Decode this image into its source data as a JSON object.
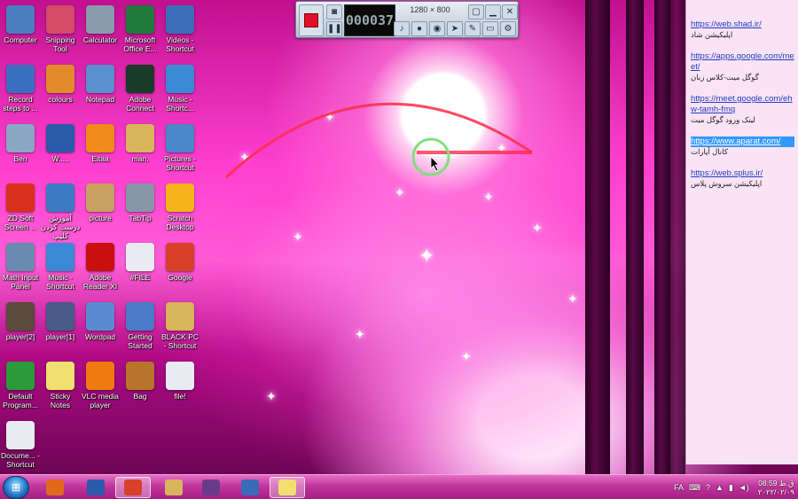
{
  "desktop": {
    "icons": [
      {
        "label": "Computer",
        "icon": "computer-icon",
        "color": "#4a7fc0"
      },
      {
        "label": "Snipping Tool",
        "icon": "scissors-icon",
        "color": "#d64a6a"
      },
      {
        "label": "Calculator",
        "icon": "calculator-icon",
        "color": "#8a9bb0"
      },
      {
        "label": "Microsoft Office E...",
        "icon": "excel-icon",
        "color": "#1f7a3c"
      },
      {
        "label": "Videos - Shortcut",
        "icon": "video-icon",
        "color": "#3d6fb8"
      },
      {
        "label": "Record steps to ...",
        "icon": "record-steps-icon",
        "color": "#3a6fbf"
      },
      {
        "label": "colours",
        "icon": "paint-icon",
        "color": "#e58a2b"
      },
      {
        "label": "Notepad",
        "icon": "notepad-icon",
        "color": "#5a8fd0"
      },
      {
        "label": "Adobe Connect",
        "icon": "adobe-connect-icon",
        "color": "#1a3a2a"
      },
      {
        "label": "Music - Shortc...",
        "icon": "music-icon",
        "color": "#3a8ad6"
      },
      {
        "label": "Ben",
        "icon": "recycle-bin-icon",
        "color": "#8aa6c4"
      },
      {
        "label": "W.....",
        "icon": "word-icon",
        "color": "#2a5aaa"
      },
      {
        "label": "Eitaa",
        "icon": "eitaa-icon",
        "color": "#f08a1a"
      },
      {
        "label": "man.",
        "icon": "folder-icon",
        "color": "#d8b45a"
      },
      {
        "label": "Pictures - Shortcut",
        "icon": "pictures-icon",
        "color": "#4b86c8"
      },
      {
        "label": "ZD Soft Screen ...",
        "icon": "zd-soft-icon",
        "color": "#d8301a"
      },
      {
        "label": "آموزش درست کردن کلیپ",
        "icon": "monitor-icon",
        "color": "#3d7ac4"
      },
      {
        "label": "picture",
        "icon": "palette-icon",
        "color": "#c8a060"
      },
      {
        "label": "TabTip",
        "icon": "pen-icon",
        "color": "#8897a8"
      },
      {
        "label": "Scratch Desktop",
        "icon": "scratch-icon",
        "color": "#f5b41c"
      },
      {
        "label": "Math Input Panel",
        "icon": "math-input-icon",
        "color": "#6a8ab0"
      },
      {
        "label": "Music - Shortcut",
        "icon": "music-icon",
        "color": "#3a8ad6"
      },
      {
        "label": "Adobe Reader XI",
        "icon": "pdf-icon",
        "color": "#c81010"
      },
      {
        "label": "#FILE",
        "icon": "file-icon",
        "color": "#e8ecf2"
      },
      {
        "label": "Google",
        "icon": "chrome-icon",
        "color": "#d8402a"
      },
      {
        "label": "player[2]",
        "icon": "film-icon",
        "color": "#5a4a3a"
      },
      {
        "label": "player[1]",
        "icon": "film-icon",
        "color": "#4a5a8a"
      },
      {
        "label": "Wordpad",
        "icon": "wordpad-icon",
        "color": "#5a8ad0"
      },
      {
        "label": "Getting Started",
        "icon": "getting-started-icon",
        "color": "#4a7ac8"
      },
      {
        "label": "BLACK PC - Shortcut",
        "icon": "folder-icon",
        "color": "#d8b45a"
      },
      {
        "label": "Default Program...",
        "icon": "default-programs-icon",
        "color": "#2a9a3a"
      },
      {
        "label": "Sticky Notes",
        "icon": "sticky-notes-icon",
        "color": "#f0e070"
      },
      {
        "label": "VLC media player",
        "icon": "vlc-icon",
        "color": "#f07a10"
      },
      {
        "label": "Bag",
        "icon": "bag-icon",
        "color": "#b8742a"
      },
      {
        "label": "file!",
        "icon": "document-icon",
        "color": "#e8ecf2"
      },
      {
        "label": "Docume... - Shortcut",
        "icon": "documents-icon",
        "color": "#e8ecf2"
      }
    ]
  },
  "recorder": {
    "timer": "000037",
    "resolution": "1280 × 800",
    "icons": [
      "stop-record-icon",
      "camera-icon",
      "pause-icon",
      "window-icon",
      "minimize-icon",
      "close-icon",
      "speaker-icon",
      "microphone-icon",
      "webcam-icon",
      "cursor-icon",
      "pencil-icon",
      "folder-icon",
      "gear-icon"
    ]
  },
  "note": {
    "entries": [
      {
        "url": "https://web.shad.ir/",
        "desc": "اپلیکیشن شاد",
        "selected": false
      },
      {
        "url": "https://apps.google.com/meet/",
        "desc": "گوگل میت-کلاس زبان",
        "selected": false
      },
      {
        "url": "https://meet.google.com/ehw-tamh-fmq",
        "desc": "لینک ورود گوگل میت",
        "selected": false
      },
      {
        "url": "https://www.aparat.com/",
        "desc": "کانال آپارات",
        "selected": true
      },
      {
        "url": "https://web.splus.ir/",
        "desc": "اپلیکیشن سروش پلاس",
        "selected": false
      }
    ]
  },
  "taskbar": {
    "start_icon": "windows-start-icon",
    "pinned": [
      {
        "icon": "firefox-icon",
        "color": "#e06a1a"
      },
      {
        "icon": "word-icon",
        "color": "#2a5aaa"
      },
      {
        "icon": "chrome-icon",
        "color": "#d8402a"
      },
      {
        "icon": "explorer-icon",
        "color": "#d8b45a"
      },
      {
        "icon": "winrar-icon",
        "color": "#6a3a8a"
      },
      {
        "icon": "remote-desktop-icon",
        "color": "#3a6ab8"
      },
      {
        "icon": "sticky-notes-icon",
        "color": "#f0e070"
      }
    ],
    "lang": "FA",
    "clock_time": "ق.ظ 08:59",
    "clock_date": "۲۰۲۲/۰۲/۰۹"
  }
}
